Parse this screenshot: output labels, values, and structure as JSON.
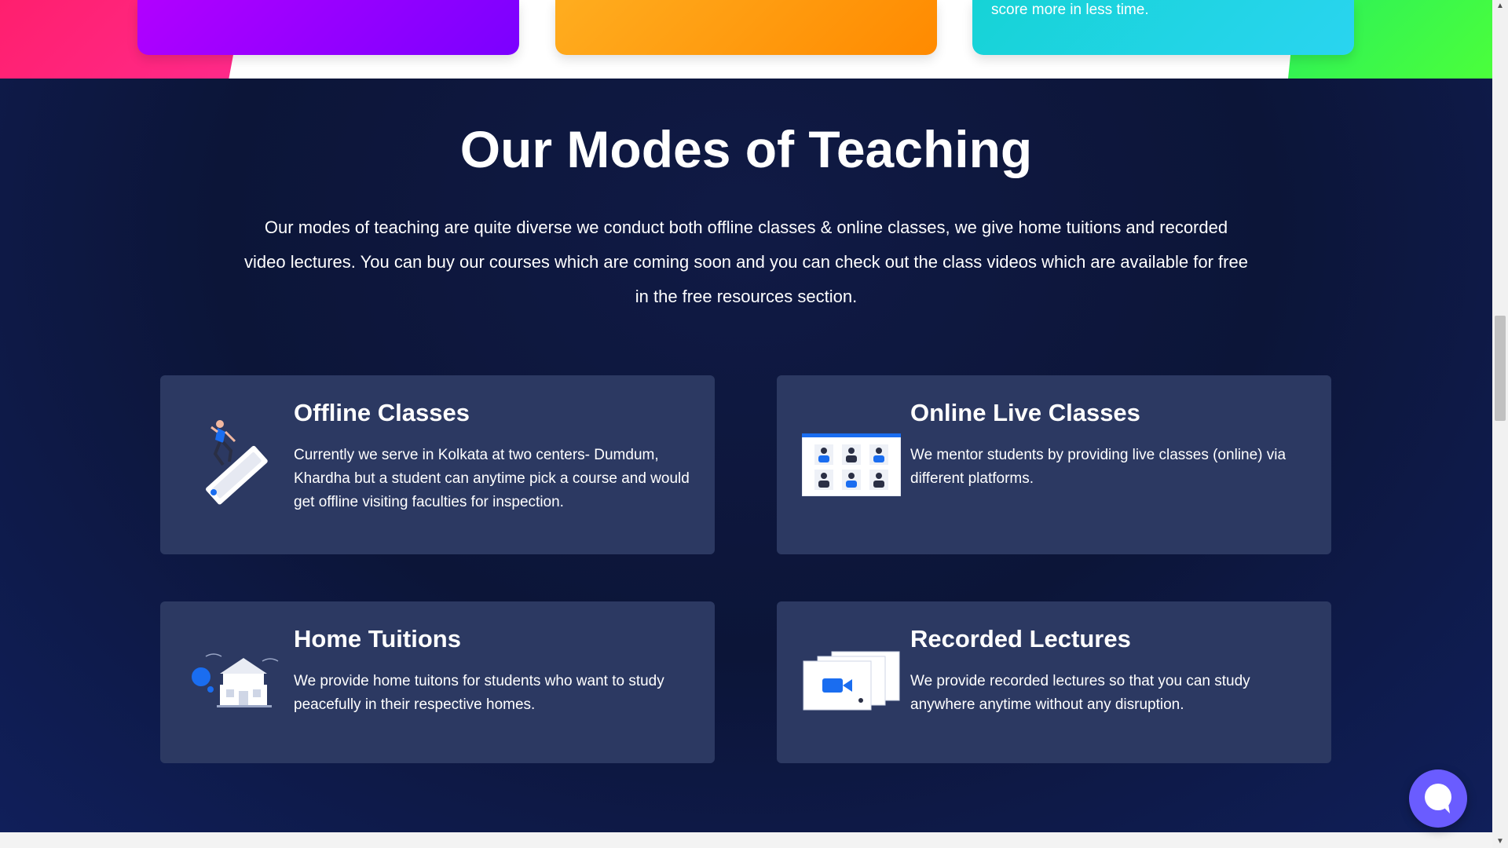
{
  "top_cards": {
    "cyan_text": "score more in less time."
  },
  "section": {
    "title": "Our Modes of Teaching",
    "description": "Our modes of teaching are quite diverse we conduct both offline classes & online classes, we give home tuitions and recorded video lectures. You can buy our courses which are coming soon and you can check out the class videos which are available for free in the free resources section."
  },
  "modes": [
    {
      "title": "Offline Classes",
      "text": "Currently we serve in Kolkata at two centers- Dumdum, Khardha but a student can anytime pick a course and would get offline visiting faculties for inspection.",
      "icon": "person-running-icon"
    },
    {
      "title": "Online Live Classes",
      "text": "We mentor students by providing live classes (online) via different platforms.",
      "icon": "video-conference-grid-icon"
    },
    {
      "title": "Home Tuitions",
      "text": "We provide home tuitons for students who want to study peacefully in their respective homes.",
      "icon": "house-icon"
    },
    {
      "title": "Recorded Lectures",
      "text": "We provide recorded lectures so that you can study anywhere anytime without any disruption.",
      "icon": "video-camera-icon"
    }
  ],
  "chat": {
    "icon": "chat-bubble-icon",
    "color": "#6a5cff"
  },
  "colors": {
    "section_bg": "#0c1538",
    "card_bg": "#2c3962",
    "accent_blue": "#1a6df0"
  }
}
